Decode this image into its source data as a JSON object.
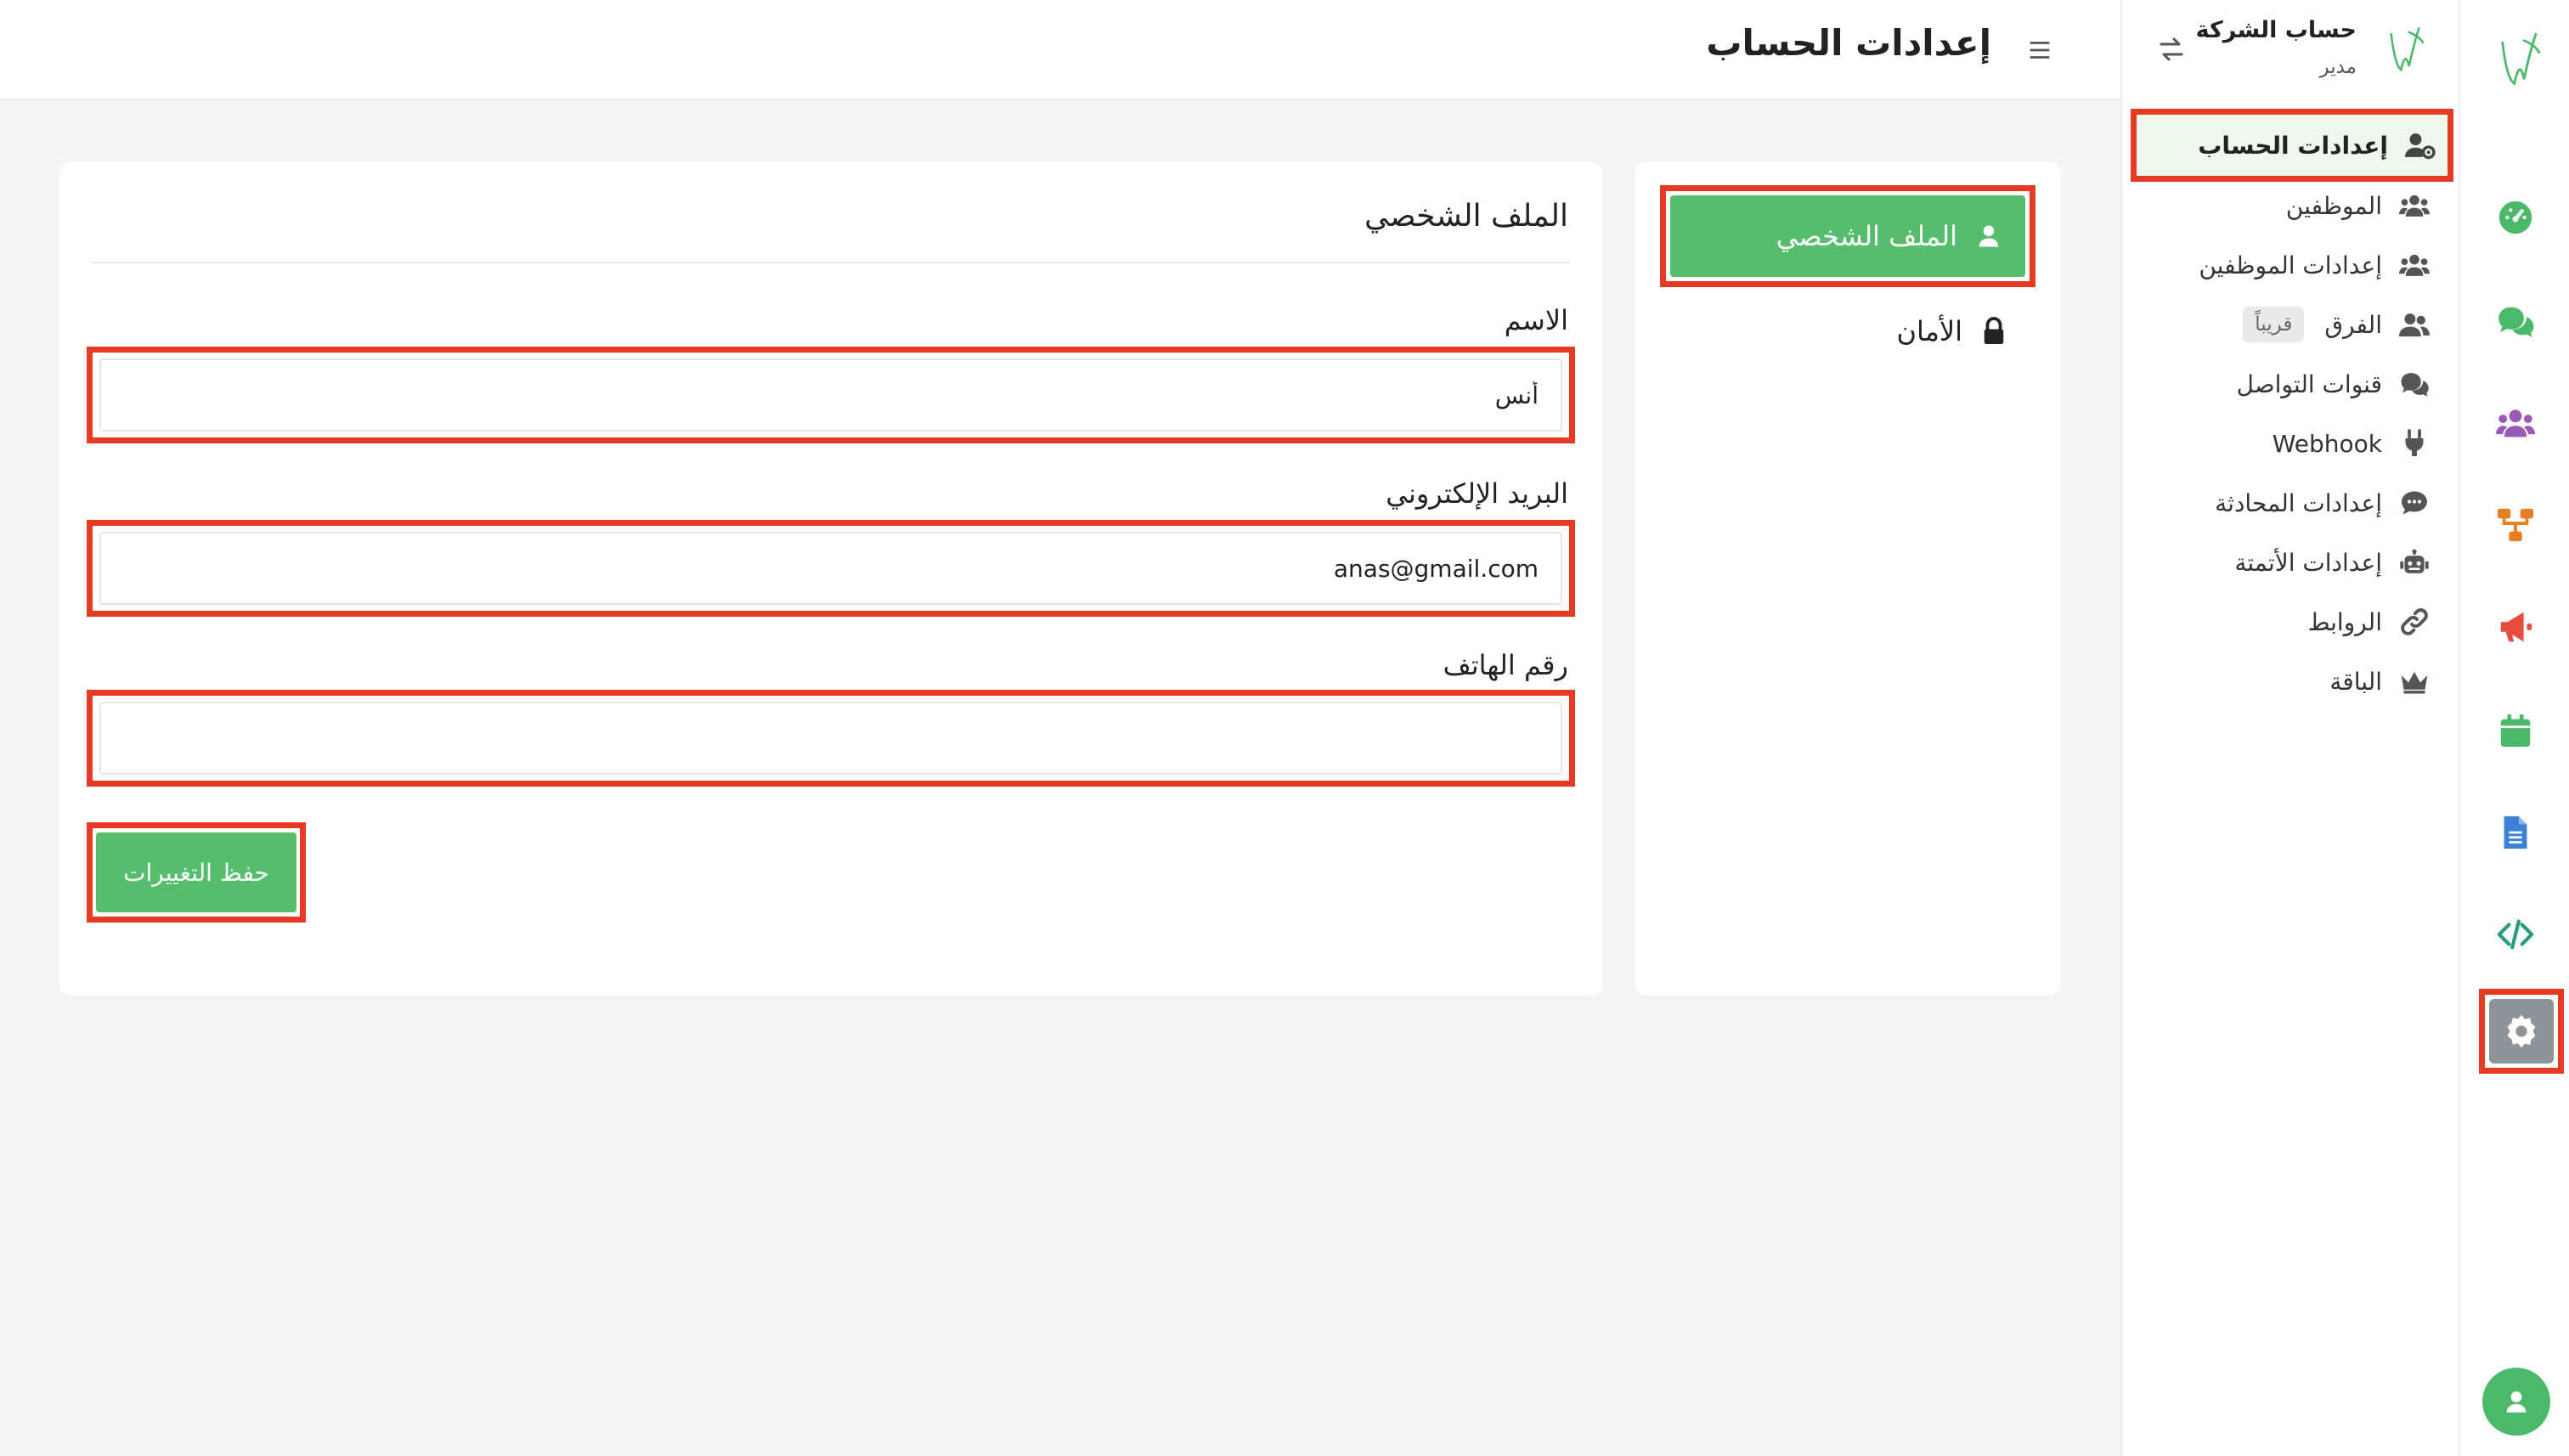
{
  "header": {
    "page_title": "إعدادات الحساب"
  },
  "company": {
    "name": "حساب الشركة",
    "role": "مدير"
  },
  "sidebar": {
    "items": [
      {
        "label": "إعدادات الحساب",
        "icon": "user-gear-icon",
        "active": true
      },
      {
        "label": "الموظفين",
        "icon": "users-icon"
      },
      {
        "label": "إعدادات الموظفين",
        "icon": "users-gear-icon"
      },
      {
        "label": "الفرق",
        "icon": "user-group-icon",
        "badge": "قريباً"
      },
      {
        "label": "قنوات التواصل",
        "icon": "comments-icon"
      },
      {
        "label": "Webhook",
        "icon": "plug-icon"
      },
      {
        "label": "إعدادات المحادثة",
        "icon": "comment-dots-icon"
      },
      {
        "label": "إعدادات الأتمتة",
        "icon": "robot-icon"
      },
      {
        "label": "الروابط",
        "icon": "link-icon"
      },
      {
        "label": "الباقة",
        "icon": "crown-icon"
      }
    ]
  },
  "rail": {
    "items": [
      {
        "name": "dashboard-gauge-icon",
        "color": "#4cb96a"
      },
      {
        "name": "chat-icon",
        "color": "#4cb96a"
      },
      {
        "name": "team-icon",
        "color": "#9b59b6"
      },
      {
        "name": "flow-icon",
        "color": "#e67e22"
      },
      {
        "name": "megaphone-icon",
        "color": "#e74c3c"
      },
      {
        "name": "calendar-icon",
        "color": "#4cb96a"
      },
      {
        "name": "document-icon",
        "color": "#3b82d6"
      },
      {
        "name": "code-icon",
        "color": "#2b9a82"
      },
      {
        "name": "settings-gear-icon",
        "color": "#8d9396",
        "active": true
      }
    ]
  },
  "profile_tabs": {
    "profile": "الملف الشخصي",
    "security": "الأمان"
  },
  "form": {
    "title": "الملف الشخصي",
    "name_label": "الاسم",
    "name_value": "أنس",
    "email_label": "البريد الإلكتروني",
    "email_value": "anas@gmail.com",
    "phone_label": "رقم الهاتف",
    "phone_value": "",
    "save_label": "حفظ التغييرات"
  },
  "colors": {
    "accent_green": "#55bd6c",
    "highlight_red": "#e53a24"
  }
}
